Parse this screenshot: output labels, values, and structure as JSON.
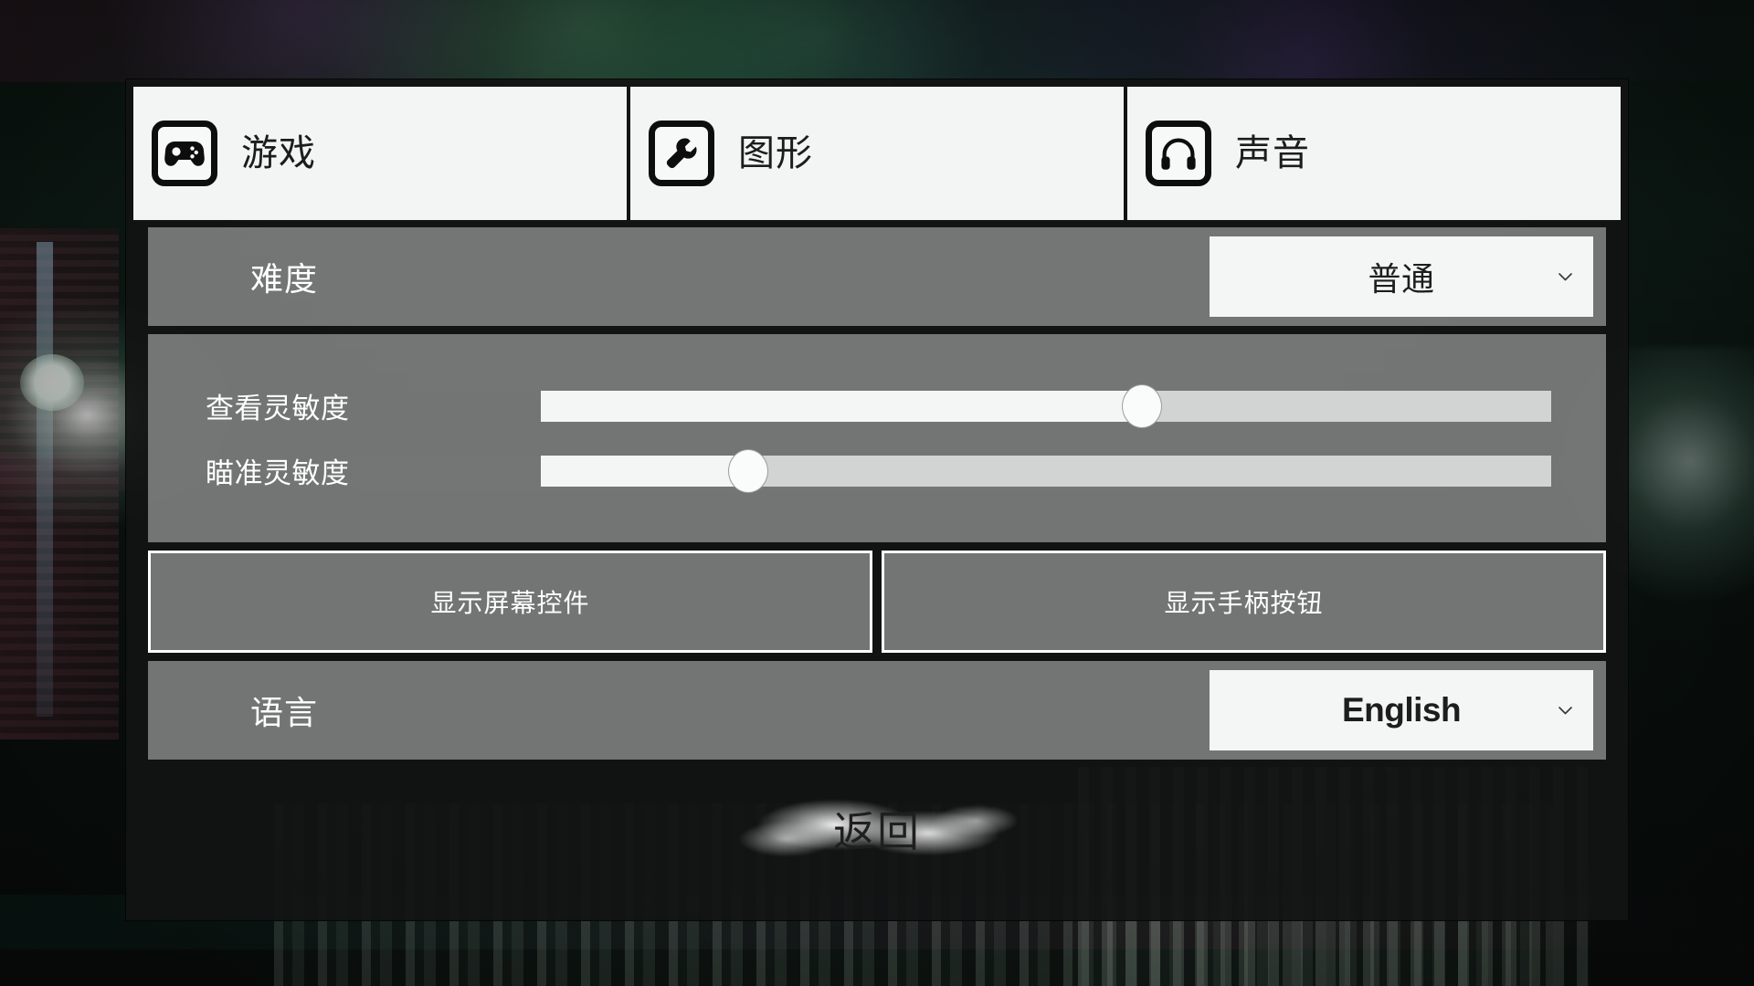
{
  "tabs": [
    {
      "label": "游戏",
      "icon": "gamepad-icon",
      "active": true
    },
    {
      "label": "图形",
      "icon": "wrench-icon",
      "active": false
    },
    {
      "label": "声音",
      "icon": "headphones-icon",
      "active": false
    }
  ],
  "difficulty": {
    "label": "难度",
    "value": "普通",
    "options": [
      "普通"
    ],
    "caret": "chevron-down-icon"
  },
  "sliders": [
    {
      "label": "查看灵敏度",
      "value": 60
    },
    {
      "label": "瞄准灵敏度",
      "value": 20
    }
  ],
  "toggles": [
    {
      "label": "显示屏幕控件"
    },
    {
      "label": "显示手柄按钮"
    }
  ],
  "language": {
    "label": "语言",
    "value": "English",
    "options": [
      "English"
    ],
    "caret": "chevron-down-icon"
  },
  "back": {
    "label": "返回"
  },
  "colors": {
    "tab_bg": "#f3f4f4",
    "row_bg": "#7e8180",
    "panel_bg": "#121414",
    "text_light": "#ffffff",
    "text_dark": "#1d1d1d",
    "slider_fill": "#f4f5f5",
    "slider_track": "#d2d3d3"
  }
}
